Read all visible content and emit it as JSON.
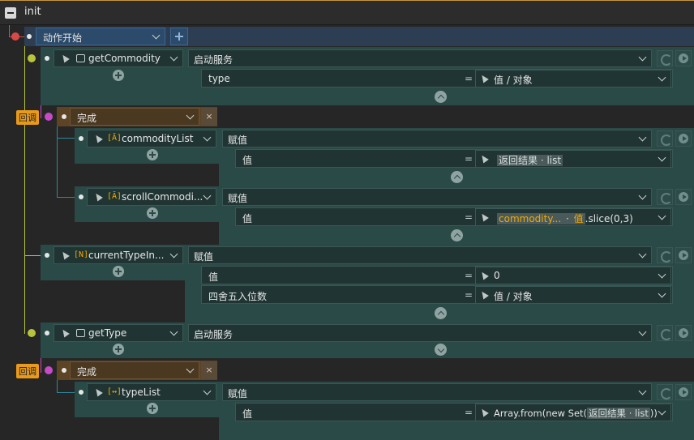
{
  "title": "init",
  "root": {
    "action": "动作开始"
  },
  "callback_tag": "回调",
  "service_label": "启动服务",
  "assign_label": "赋值",
  "equals": "=",
  "placeholder": "值 / 对象",
  "done_label": "完成",
  "close_glyph": "×",
  "nodes": {
    "getCommodity": {
      "name": "getCommodity",
      "param": "type"
    },
    "commodityList": {
      "name": "commodityList",
      "param": "值",
      "value_ref": "返回结果 · list"
    },
    "scrollCommodity": {
      "name": "scrollCommodi...",
      "param": "值",
      "value_ref1": "commodity...",
      "value_sep": " · ",
      "value_ref2": "值",
      "value_suffix": ".slice(0,3)"
    },
    "currentTypeIndex": {
      "name": "currentTypeIn...",
      "param1": "值",
      "value1": "0",
      "param2": "四舍五入位数"
    },
    "getType": {
      "name": "getType"
    },
    "typeList": {
      "name": "typeList",
      "param": "值",
      "value_prefix": "Array.from(new Set(",
      "value_ref": "返回结果 · list",
      "value_suffix": "))"
    }
  },
  "icons": {
    "box_icon": "[N]",
    "cursor": "cursor-icon",
    "refresh": "refresh-icon",
    "play": "play-icon"
  },
  "colors": {
    "accent_orange": "#e89a1a",
    "teal_panel": "#2a4a48",
    "link_red": "#d84a4a",
    "link_yellow": "#b8c43c",
    "link_magenta": "#c84ac8",
    "root_blue": "#2c4a6a"
  }
}
